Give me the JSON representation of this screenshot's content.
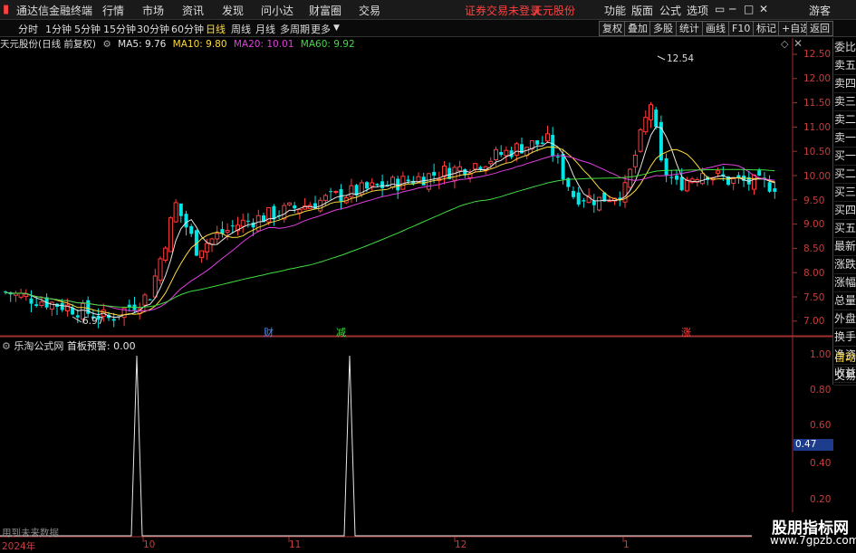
{
  "menu": {
    "app_title": "通达信金融终端",
    "items": [
      "行情",
      "市场",
      "资讯",
      "发现",
      "问小达",
      "财富圈",
      "交易"
    ],
    "warning": "证券交易未登录",
    "stock": "天元股份",
    "right_items": [
      "功能",
      "版面",
      "公式",
      "选项"
    ],
    "guest": "游客",
    "window_buttons": [
      "▭",
      "─",
      "□",
      "✕"
    ]
  },
  "period_tabs": [
    "分时",
    "1分钟",
    "5分钟",
    "15分钟",
    "30分钟",
    "60分钟",
    "日线",
    "周线",
    "月线",
    "多周期",
    "更多"
  ],
  "active_period": "日线",
  "toolbar_buttons": [
    "复权",
    "叠加",
    "多股",
    "统计",
    "画线",
    "F10",
    "标记",
    "+自选",
    "返回"
  ],
  "main_chart": {
    "title": "天元股份(日线 前复权)",
    "ma": [
      {
        "label": "MA5: 9.76",
        "color": "#e6e6e6"
      },
      {
        "label": "MA10: 9.80",
        "color": "#ffdc3c"
      },
      {
        "label": "MA20: 10.01",
        "color": "#e040e0"
      },
      {
        "label": "MA60: 9.92",
        "color": "#40dc40"
      }
    ],
    "high_label": "12.54",
    "low_label": "6.97",
    "y_ticks": [
      "12.50",
      "12.00",
      "11.50",
      "11.00",
      "10.50",
      "10.00",
      "9.50",
      "9.00",
      "8.50",
      "8.00",
      "7.50",
      "7.00"
    ],
    "event_labels": [
      {
        "text": "财",
        "color": "#4a8cff"
      },
      {
        "text": "减",
        "color": "#40dc40"
      },
      {
        "text": "涨",
        "color": "#ff4040"
      }
    ]
  },
  "side_tabs": [
    "委比",
    "卖五",
    "卖四",
    "卖三",
    "卖二",
    "卖一",
    "买一",
    "买二",
    "买三",
    "买四",
    "买五",
    "最新",
    "涨跌",
    "涨幅",
    "总量",
    "外盘",
    "换手",
    "净资",
    "收益"
  ],
  "sub_chart": {
    "title": "乐淘公式网",
    "indicator": "首板预警: 0.00",
    "y_ticks": [
      "1.00",
      "0.80",
      "0.60",
      "0.40",
      "0.20"
    ],
    "current_value": "0.47",
    "footnote": "用到未来数据"
  },
  "sub_side_tabs": [
    "自动",
    "交易"
  ],
  "x_labels": [
    "2024年",
    "10",
    "11",
    "12",
    "1"
  ],
  "watermark": {
    "line1": "股朋指标网",
    "line2": "www.7gpzb.com"
  },
  "colors": {
    "up": "#ff3c3c",
    "down": "#00e6e6",
    "ma5": "#e6e6e6",
    "ma10": "#ffdc3c",
    "ma20": "#e040e0",
    "ma60": "#40dc40"
  }
}
